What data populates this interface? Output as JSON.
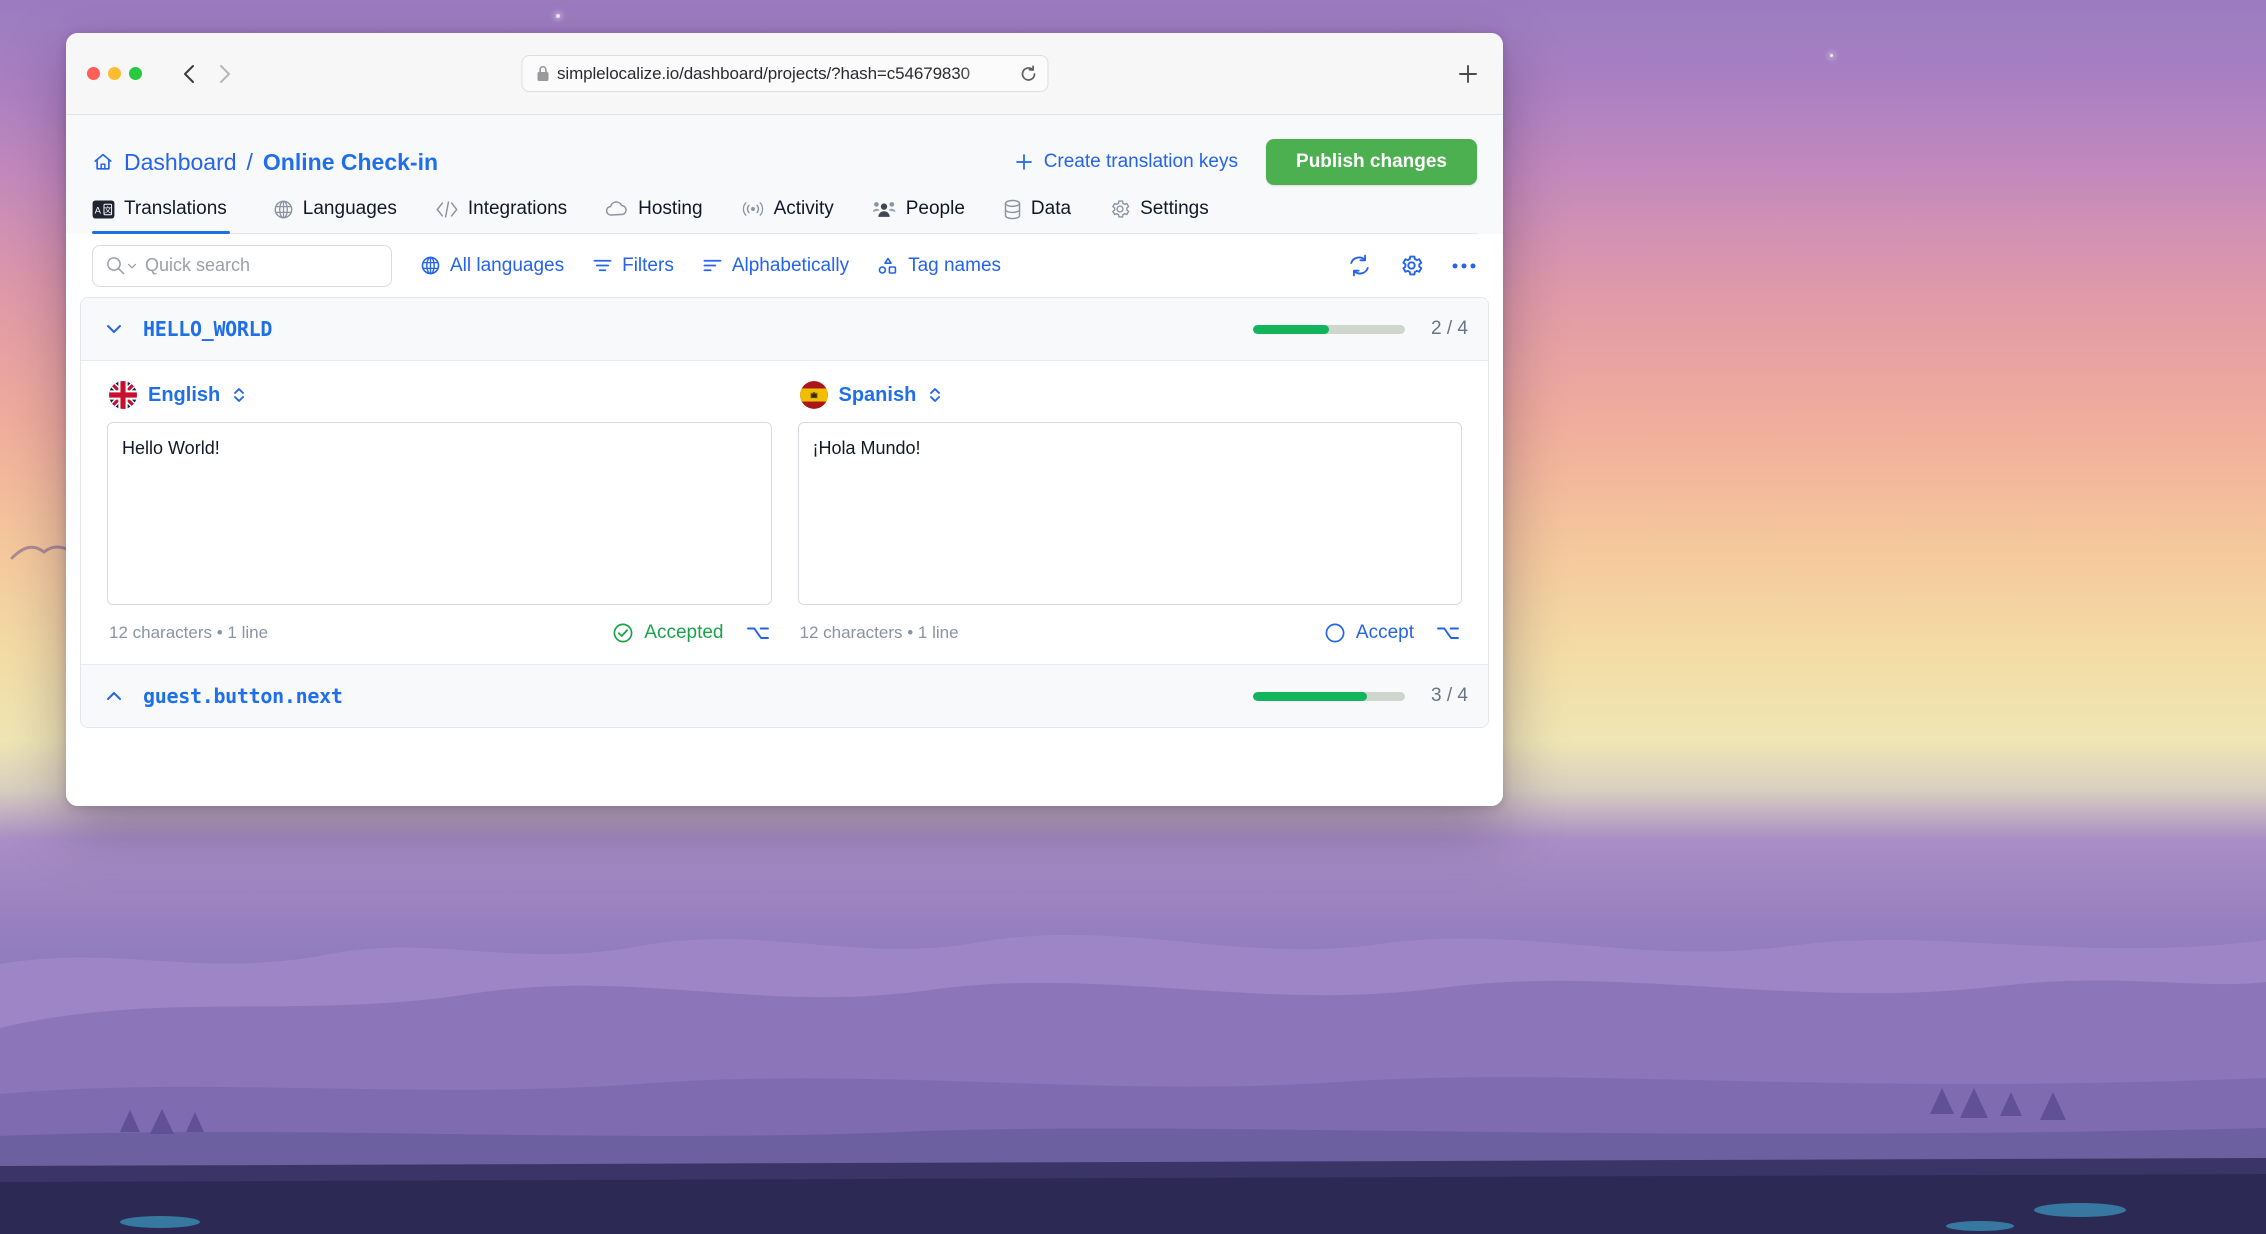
{
  "browser": {
    "url": "simplelocalize.io/dashboard/projects/?hash=c54679830",
    "back_label": "Back",
    "forward_label": "Forward",
    "reload_label": "Reload",
    "new_tab_label": "New tab",
    "lock_icon": "lock-icon",
    "traffic_lights": [
      "close",
      "minimize",
      "maximize"
    ]
  },
  "header": {
    "breadcrumb": {
      "home_icon": "home-icon",
      "root": "Dashboard",
      "separator": "/",
      "current": "Online Check-in"
    },
    "create_keys_label": "Create translation keys",
    "create_keys_icon": "plus-icon",
    "publish_label": "Publish changes",
    "publish_color": "#4caf50"
  },
  "tabs": [
    {
      "label": "Translations",
      "icon": "translate-icon",
      "active": true
    },
    {
      "label": "Languages",
      "icon": "globe-icon",
      "active": false
    },
    {
      "label": "Integrations",
      "icon": "code-icon",
      "active": false
    },
    {
      "label": "Hosting",
      "icon": "cloud-icon",
      "active": false
    },
    {
      "label": "Activity",
      "icon": "broadcast-icon",
      "active": false
    },
    {
      "label": "People",
      "icon": "people-icon",
      "active": false
    },
    {
      "label": "Data",
      "icon": "database-icon",
      "active": false
    },
    {
      "label": "Settings",
      "icon": "gear-icon",
      "active": false
    }
  ],
  "toolbar": {
    "search_placeholder": "Quick search",
    "search_value": "",
    "search_icon": "search-icon",
    "links": [
      {
        "label": "All languages",
        "icon": "globe-icon"
      },
      {
        "label": "Filters",
        "icon": "filter-icon"
      },
      {
        "label": "Alphabetically",
        "icon": "sort-icon"
      },
      {
        "label": "Tag names",
        "icon": "tag-shapes-icon"
      }
    ],
    "icons": [
      {
        "name": "refresh-icon"
      },
      {
        "name": "gear-icon"
      },
      {
        "name": "more-horizontal-icon"
      }
    ]
  },
  "keys": [
    {
      "name": "HELLO_WORLD",
      "expanded": true,
      "chevron": "chevron-down-icon",
      "progress_done": 2,
      "progress_total": 4,
      "progress_label": "2 / 4",
      "progress_percent": 50,
      "translations": [
        {
          "language": "English",
          "flag": "uk-flag",
          "value": "Hello World!",
          "char_info": "12 characters • 1 line",
          "status_label": "Accepted",
          "status_state": "accepted",
          "shortcut_icon": "option-key-icon"
        },
        {
          "language": "Spanish",
          "flag": "spain-flag",
          "value": "¡Hola Mundo!",
          "char_info": "12 characters • 1 line",
          "status_label": "Accept",
          "status_state": "pending",
          "shortcut_icon": "option-key-icon"
        }
      ]
    },
    {
      "name": "guest.button.next",
      "expanded": false,
      "chevron": "chevron-up-icon",
      "progress_done": 3,
      "progress_total": 4,
      "progress_label": "3 / 4",
      "progress_percent": 75,
      "translations": []
    }
  ],
  "colors": {
    "accent_blue": "#2563eb",
    "link_blue": "#1f6feb",
    "success_green": "#12b45c",
    "publish_green": "#4caf50",
    "muted_gray": "#8b93a1"
  }
}
